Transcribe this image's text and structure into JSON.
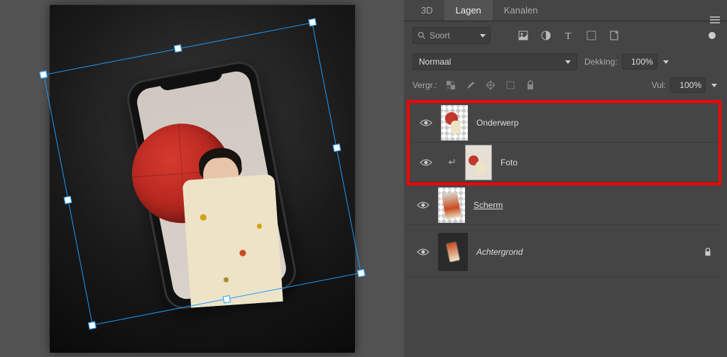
{
  "tabs": {
    "tab3d": "3D",
    "layers": "Lagen",
    "channels": "Kanalen"
  },
  "search": {
    "placeholder": "Soort"
  },
  "blend": {
    "mode": "Normaal",
    "opacity_label": "Dekking:",
    "opacity_value": "100%"
  },
  "lock": {
    "label": "Vergr.:"
  },
  "fill": {
    "label": "Vul:",
    "value": "100%"
  },
  "layers": [
    {
      "name": "Onderwerp"
    },
    {
      "name": "Foto"
    },
    {
      "name": "Scherm "
    },
    {
      "name": "Achtergrond"
    }
  ]
}
